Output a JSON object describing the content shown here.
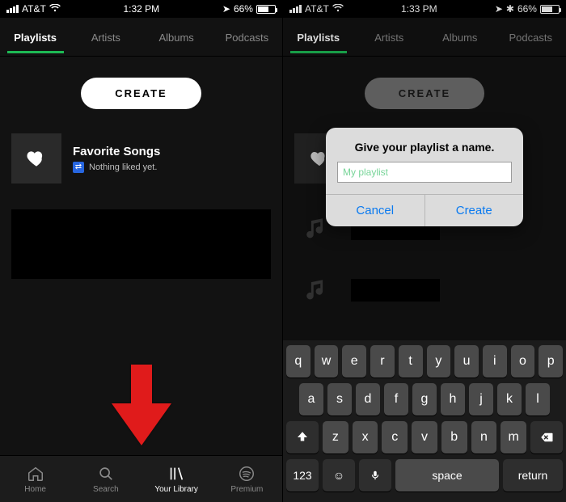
{
  "left": {
    "status": {
      "carrier": "AT&T",
      "time": "1:32 PM",
      "battery": "66%"
    },
    "tabs": [
      "Playlists",
      "Artists",
      "Albums",
      "Podcasts"
    ],
    "active_tab": 0,
    "create_label": "CREATE",
    "favorite": {
      "title": "Favorite Songs",
      "subtitle": "Nothing liked yet."
    },
    "bottom_nav": [
      {
        "label": "Home"
      },
      {
        "label": "Search"
      },
      {
        "label": "Your Library"
      },
      {
        "label": "Premium"
      }
    ],
    "bottom_active": 2
  },
  "right": {
    "status": {
      "carrier": "AT&T",
      "time": "1:33 PM",
      "battery": "66%"
    },
    "tabs": [
      "Playlists",
      "Artists",
      "Albums",
      "Podcasts"
    ],
    "active_tab": 0,
    "create_label": "CREATE",
    "modal": {
      "title": "Give your playlist a name.",
      "placeholder": "My playlist",
      "cancel": "Cancel",
      "create": "Create"
    },
    "keyboard": {
      "row1": [
        "q",
        "w",
        "e",
        "r",
        "t",
        "y",
        "u",
        "i",
        "o",
        "p"
      ],
      "row2": [
        "a",
        "s",
        "d",
        "f",
        "g",
        "h",
        "j",
        "k",
        "l"
      ],
      "row3": [
        "z",
        "x",
        "c",
        "v",
        "b",
        "n",
        "m"
      ],
      "num": "123",
      "space": "space",
      "ret": "return"
    }
  },
  "colors": {
    "accent": "#1DB954",
    "arrow": "#E01B1B"
  }
}
